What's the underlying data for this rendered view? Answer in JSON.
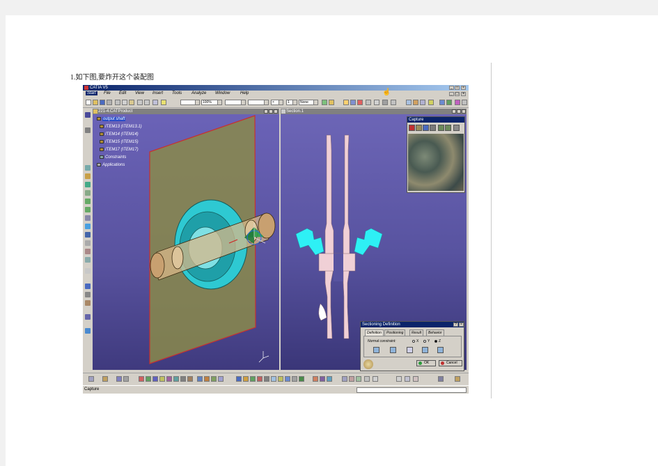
{
  "caption": "1.如下图,要炸开这个装配图",
  "app": {
    "title": "CATIA V5",
    "menu": [
      "Start",
      "File",
      "Edit",
      "View",
      "Insert",
      "Tools",
      "Analyze",
      "Window",
      "Help"
    ],
    "toolbar": {
      "zoom": "100%",
      "count": "1",
      "style": "None"
    }
  },
  "window1": {
    "title": "221-4.CATProduct",
    "tree": [
      "output shaft",
      "ITEM13 (ITEM13.1)",
      "ITEM14 (ITEM14)",
      "ITEM15 (ITEM15)",
      "ITEM17 (ITEM17)",
      "Constraints",
      "Applications"
    ]
  },
  "window2": {
    "title": "Section.1"
  },
  "capture_panel": {
    "title": "Capture"
  },
  "sectioning": {
    "title": "Sectioning Definition",
    "tabs": [
      "Definition",
      "Positioning",
      "Result",
      "Behavior"
    ],
    "normal_label": "Normal constraint:",
    "options": [
      "X",
      "Y",
      "Z"
    ],
    "ok": "OK",
    "cancel": "Cancel"
  },
  "status": {
    "text": "Capture"
  },
  "colors": {
    "background_top": "#6b63b8",
    "background_bottom": "#3f3a7e",
    "plane": "#8a8a4a",
    "gear": "#2ec9d2",
    "section_part": "#f0d0d6"
  }
}
